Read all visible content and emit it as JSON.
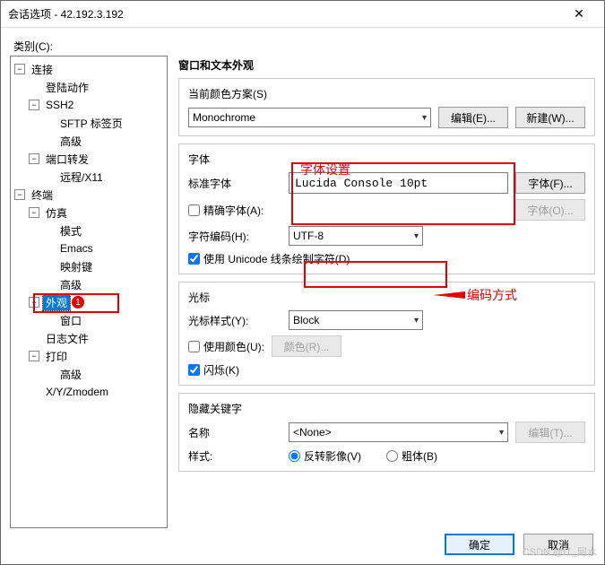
{
  "title": "会话选项 - 42.192.3.192",
  "category_label": "类别(C):",
  "tree": {
    "connection": "连接",
    "login": "登陆动作",
    "ssh2": "SSH2",
    "sftp": "SFTP 标签页",
    "adv1": "高级",
    "portfwd": "端口转发",
    "remote": "远程/X11",
    "terminal": "终端",
    "emul": "仿真",
    "mode": "模式",
    "emacs": "Emacs",
    "mapkeys": "映射键",
    "adv2": "高级",
    "appearance": "外观",
    "window": "窗口",
    "logfiles": "日志文件",
    "print": "打印",
    "adv3": "高级",
    "xyzmodem": "X/Y/Zmodem"
  },
  "section_title": "窗口和文本外观",
  "scheme": {
    "label": "当前颜色方案(S)",
    "value": "Monochrome",
    "edit_btn": "编辑(E)...",
    "new_btn": "新建(W)..."
  },
  "font": {
    "legend": "字体",
    "label": "标准字体",
    "value": "Lucida Console 10pt",
    "font_btn": "字体(F)...",
    "precise_label": "精确字体(A):",
    "font_btn2": "字体(O)...",
    "encoding_label": "字符编码(H):",
    "encoding_value": "UTF-8",
    "unicode_label": "使用 Unicode 线条绘制字符(D)"
  },
  "cursor": {
    "legend": "光标",
    "style_label": "光标样式(Y):",
    "style_value": "Block",
    "use_color_label": "使用颜色(U):",
    "color_btn": "颜色(R)...",
    "blink_label": "闪烁(K)"
  },
  "keywords": {
    "legend": "隐藏关键字",
    "name_label": "名称",
    "name_value": "<None>",
    "edit_btn": "编辑(T)...",
    "style_label": "样式:",
    "invert_label": "反转影像(V)",
    "bold_label": "粗体(B)"
  },
  "buttons": {
    "ok": "确定",
    "cancel": "取消"
  },
  "anno": {
    "font_label": "字体设置",
    "encoding_label": "编码方式",
    "marker": "1"
  },
  "watermark": "CSDN @IT_阿水"
}
